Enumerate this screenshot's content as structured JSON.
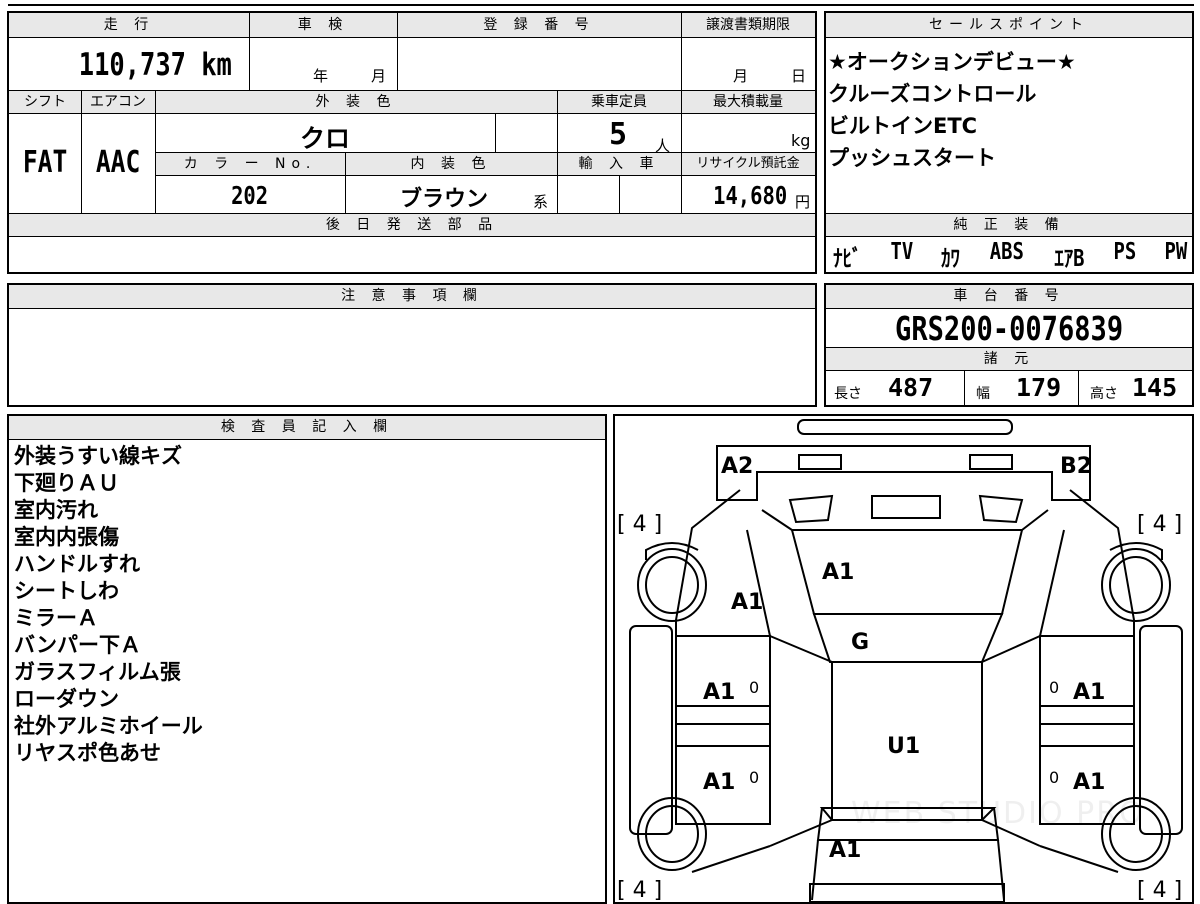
{
  "sheet": {
    "top": {
      "mileage_header": "走 行",
      "mileage_value": "110,737 km",
      "shaken_header": "車 検",
      "shaken_year": "年",
      "shaken_month": "月",
      "reg_header": "登 録 番 号",
      "deadline_header": "譲渡書類期限",
      "deadline_month": "月",
      "deadline_day": "日"
    },
    "mid": {
      "shift_header": "シフト",
      "shift_value": "FAT",
      "ac_header": "エアコン",
      "ac_value": "AAC",
      "color_header": "外 装 色",
      "color_value": "クロ",
      "capacity_header": "乗車定員",
      "capacity_value": "5",
      "capacity_unit": "人",
      "maxload_header": "最大積載量",
      "maxload_unit": "kg",
      "colorno_header": "カ ラ ー No.",
      "colorno_value": "202",
      "interior_header": "内 装 色",
      "interior_value": "ブラウン",
      "interior_suffix": "系",
      "import_header": "輸 入 車",
      "recycle_header": "リサイクル預託金",
      "recycle_value": "14,680",
      "recycle_unit": "円",
      "later_header": "後 日 発 送 部 品"
    },
    "sales": {
      "header": "セールスポイント",
      "points": [
        "★オークションデビュー★",
        "クルーズコントロール",
        "ビルトインETC",
        "プッシュスタート"
      ]
    },
    "equipment": {
      "header": "純 正 装 備",
      "items": [
        "ﾅﾋﾞ",
        "TV",
        "ｶﾜ",
        "ABS",
        "ｴｱB",
        "PS",
        "PW"
      ]
    },
    "caution": {
      "header": "注 意 事 項 欄"
    },
    "chassis": {
      "header": "車 台 番 号",
      "value": "GRS200-0076839",
      "spec_header": "諸 元",
      "length_label": "長さ",
      "length_value": "487",
      "width_label": "幅",
      "width_value": "179",
      "height_label": "高さ",
      "height_value": "145"
    },
    "inspector": {
      "header": "検 査 員 記 入 欄",
      "notes": [
        "外装うすい線キズ",
        "下廻りＡＵ",
        "室内汚れ",
        "室内内張傷",
        "ハンドルすれ",
        "シートしわ",
        "ミラーＡ",
        "バンパー下Ａ",
        "ガラスフィルム張",
        "ローダウン",
        "社外アルミホイール",
        "リヤスポ色あせ"
      ]
    },
    "diagram": {
      "front_left": "A2",
      "front_right": "B2",
      "hood": "A1",
      "front_fender_left": "A1",
      "windshield": "G",
      "front_door_left": "A1",
      "front_door_right": "A1",
      "roof": "U1",
      "rear_door_left": "A1",
      "rear_door_right": "A1",
      "trunk": "A1",
      "door_marks": [
        "0",
        "0",
        "0",
        "0"
      ],
      "tire_tl": "[ 4 ]",
      "tire_tr": "[ 4 ]",
      "tire_bl": "[ 4 ]",
      "tire_br": "[ 4 ]",
      "watermark": "WEB STUDIO PRO"
    }
  }
}
